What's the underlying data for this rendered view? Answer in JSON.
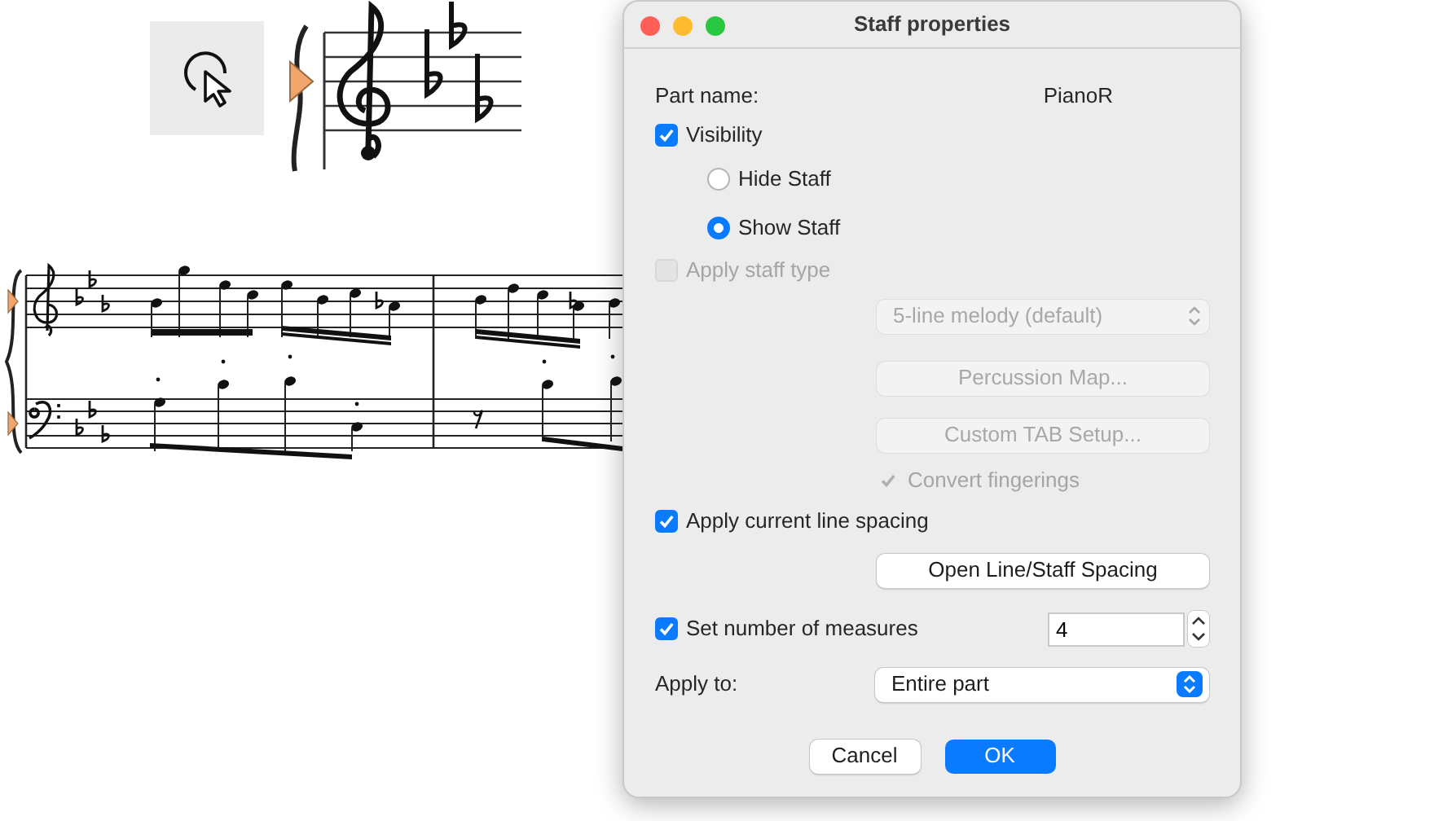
{
  "dialog": {
    "title": "Staff properties",
    "part_name_label": "Part name:",
    "part_name": "PianoR",
    "visibility": {
      "label": "Visibility",
      "checked": true,
      "disabled": false
    },
    "staff_options": [
      {
        "label": "Hide Staff",
        "selected": false
      },
      {
        "label": "Show Staff",
        "selected": true
      }
    ],
    "apply_staff_type": {
      "label": "Apply staff type",
      "checked": false,
      "disabled": true
    },
    "staff_type_select": {
      "value": "5-line melody (default)",
      "disabled": true
    },
    "percussion_button": {
      "label": "Percussion Map...",
      "disabled": true
    },
    "tab_button": {
      "label": "Custom TAB Setup...",
      "disabled": true
    },
    "convert_fingerings": {
      "label": "Convert fingerings",
      "checked": true,
      "disabled": true
    },
    "line_spacing": {
      "label": "Apply current line spacing",
      "checked": true,
      "disabled": false
    },
    "spacing_button": {
      "label": "Open Line/Staff Spacing",
      "disabled": false
    },
    "measures": {
      "label": "Set number of measures",
      "checked": true,
      "disabled": false,
      "value": "4"
    },
    "apply_to": {
      "label": "Apply to:",
      "value": "Entire part"
    },
    "buttons": [
      {
        "label": "Cancel",
        "kind": "secondary"
      },
      {
        "label": "OK",
        "kind": "primary"
      }
    ]
  }
}
